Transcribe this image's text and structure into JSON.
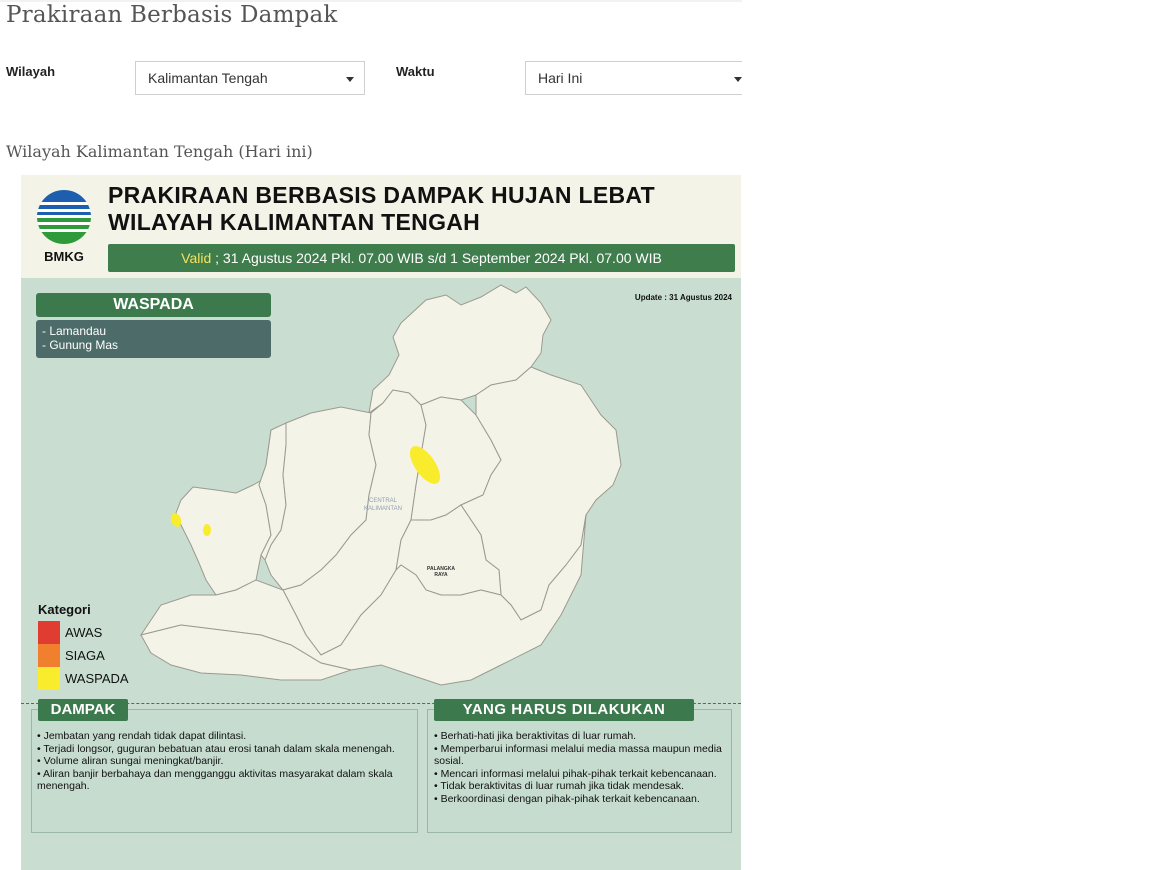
{
  "page": {
    "title": "Prakiraan Berbasis Dampak"
  },
  "filters": {
    "region_label": "Wilayah",
    "region_value": "Kalimantan Tengah",
    "time_label": "Waktu",
    "time_value": "Hari Ini"
  },
  "section": {
    "title": "Wilayah Kalimantan Tengah (Hari ini)"
  },
  "infographic": {
    "logo_text": "BMKG",
    "title_line1": "PRAKIRAAN BERBASIS DAMPAK HUJAN LEBAT",
    "title_line2": "WILAYAH KALIMANTAN TENGAH",
    "valid_prefix": "Valid",
    "valid_text": " ; 31 Agustus 2024 Pkl. 07.00 WIB s/d 1 September 2024 Pkl. 07.00 WIB",
    "update_text": "Update : 31 Agustus 2024",
    "waspada_header": "WASPADA",
    "waspada_areas": [
      "- Lamandau",
      "- Gunung Mas"
    ],
    "map_labels": {
      "central_line1": "CENTRAL",
      "central_line2": "KALIMANTAN",
      "city_line1": "PALANGKA",
      "city_line2": "RAYA"
    },
    "legend": {
      "title": "Kategori",
      "items": [
        {
          "label": "AWAS",
          "color": "#e03c31"
        },
        {
          "label": "SIAGA",
          "color": "#f07f2e"
        },
        {
          "label": "WASPADA",
          "color": "#f9ec2c"
        }
      ]
    },
    "dampak": {
      "header": "DAMPAK",
      "items": [
        "• Jembatan yang rendah tidak dapat dilintasi.",
        "• Terjadi longsor, guguran bebatuan atau erosi tanah dalam skala menengah.",
        "• Volume aliran sungai meningkat/banjir.",
        "• Aliran banjir berbahaya dan mengganggu aktivitas masyarakat dalam skala menengah."
      ]
    },
    "tindakan": {
      "header": "YANG HARUS DILAKUKAN",
      "items": [
        "• Berhati-hati jika beraktivitas di luar rumah.",
        "• Memperbarui informasi melalui media massa maupun media sosial.",
        "• Mencari informasi melalui pihak-pihak terkait kebencanaan.",
        "• Tidak beraktivitas di luar rumah jika tidak mendesak.",
        "• Berkoordinasi dengan pihak-pihak terkait kebencanaan."
      ]
    },
    "colors": {
      "header_green": "#3c7a4e",
      "map_bg": "#c9ddd1",
      "land": "#f4f3e7",
      "warning_yellow": "#f9ec2c"
    }
  }
}
